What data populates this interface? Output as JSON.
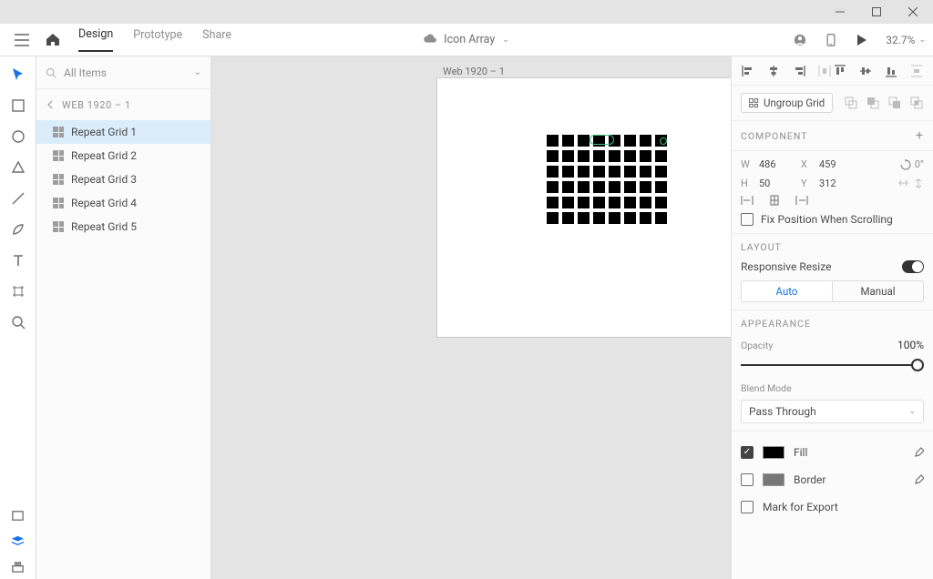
{
  "titlebar": {},
  "topbar": {
    "tabs": {
      "design": "Design",
      "prototype": "Prototype",
      "share": "Share"
    },
    "doc_title": "Icon Array",
    "zoom": "32.7%"
  },
  "layers": {
    "search_placeholder": "All Items",
    "crumb": "WEB 1920 – 1",
    "items": [
      {
        "label": "Repeat Grid 1"
      },
      {
        "label": "Repeat Grid 2"
      },
      {
        "label": "Repeat Grid 3"
      },
      {
        "label": "Repeat Grid 4"
      },
      {
        "label": "Repeat Grid 5"
      }
    ]
  },
  "canvas": {
    "artboard_label": "Web 1920 – 1"
  },
  "props": {
    "ungroup": "Ungroup Grid",
    "component_head": "Component",
    "w_label": "W",
    "w_val": "486",
    "x_label": "X",
    "x_val": "459",
    "h_label": "H",
    "h_val": "50",
    "y_label": "Y",
    "y_val": "312",
    "rotation": "0°",
    "fix_pos": "Fix Position When Scrolling",
    "layout_head": "Layout",
    "responsive": "Responsive Resize",
    "auto": "Auto",
    "manual": "Manual",
    "appearance_head": "Appearance",
    "opacity_label": "Opacity",
    "opacity_val": "100%",
    "blend_label": "Blend Mode",
    "blend_val": "Pass Through",
    "fill_label": "Fill",
    "border_label": "Border",
    "export_label": "Mark for Export"
  }
}
